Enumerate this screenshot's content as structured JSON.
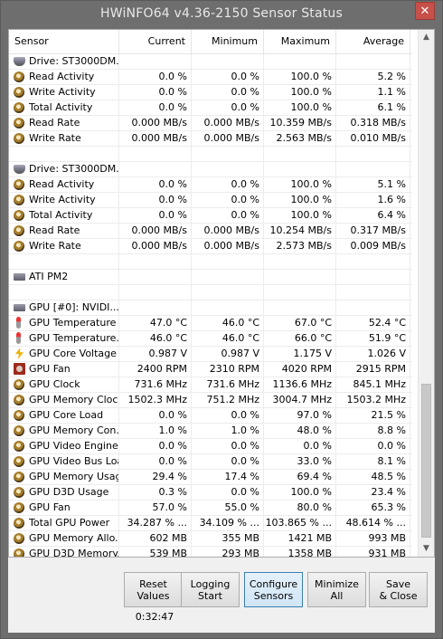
{
  "window": {
    "title": "HWiNFO64 v4.36-2150 Sensor Status",
    "close_glyph": "✕"
  },
  "columns": {
    "sensor": "Sensor",
    "current": "Current",
    "minimum": "Minimum",
    "maximum": "Maximum",
    "average": "Average"
  },
  "rows": [
    {
      "icon": "drive-icon",
      "name": "Drive: ST3000DM...",
      "cur": "",
      "min": "",
      "max": "",
      "avg": ""
    },
    {
      "icon": "gauge-icon",
      "name": "Read Activity",
      "cur": "0.0 %",
      "min": "0.0 %",
      "max": "100.0 %",
      "avg": "5.2 %"
    },
    {
      "icon": "gauge-icon",
      "name": "Write Activity",
      "cur": "0.0 %",
      "min": "0.0 %",
      "max": "100.0 %",
      "avg": "1.1 %"
    },
    {
      "icon": "gauge-icon",
      "name": "Total Activity",
      "cur": "0.0 %",
      "min": "0.0 %",
      "max": "100.0 %",
      "avg": "6.1 %"
    },
    {
      "icon": "gauge-icon",
      "name": "Read Rate",
      "cur": "0.000 MB/s",
      "min": "0.000 MB/s",
      "max": "10.359 MB/s",
      "avg": "0.318 MB/s"
    },
    {
      "icon": "gauge-icon",
      "name": "Write Rate",
      "cur": "0.000 MB/s",
      "min": "0.000 MB/s",
      "max": "2.563 MB/s",
      "avg": "0.010 MB/s"
    },
    {
      "icon": "",
      "name": "",
      "cur": "",
      "min": "",
      "max": "",
      "avg": ""
    },
    {
      "icon": "drive-icon",
      "name": "Drive: ST3000DM...",
      "cur": "",
      "min": "",
      "max": "",
      "avg": ""
    },
    {
      "icon": "gauge-icon",
      "name": "Read Activity",
      "cur": "0.0 %",
      "min": "0.0 %",
      "max": "100.0 %",
      "avg": "5.1 %"
    },
    {
      "icon": "gauge-icon",
      "name": "Write Activity",
      "cur": "0.0 %",
      "min": "0.0 %",
      "max": "100.0 %",
      "avg": "1.6 %"
    },
    {
      "icon": "gauge-icon",
      "name": "Total Activity",
      "cur": "0.0 %",
      "min": "0.0 %",
      "max": "100.0 %",
      "avg": "6.4 %"
    },
    {
      "icon": "gauge-icon",
      "name": "Read Rate",
      "cur": "0.000 MB/s",
      "min": "0.000 MB/s",
      "max": "10.254 MB/s",
      "avg": "0.317 MB/s"
    },
    {
      "icon": "gauge-icon",
      "name": "Write Rate",
      "cur": "0.000 MB/s",
      "min": "0.000 MB/s",
      "max": "2.573 MB/s",
      "avg": "0.009 MB/s"
    },
    {
      "icon": "",
      "name": "",
      "cur": "",
      "min": "",
      "max": "",
      "avg": ""
    },
    {
      "icon": "chip-icon",
      "name": "ATI PM2",
      "cur": "",
      "min": "",
      "max": "",
      "avg": ""
    },
    {
      "icon": "",
      "name": "",
      "cur": "",
      "min": "",
      "max": "",
      "avg": ""
    },
    {
      "icon": "chip-icon",
      "name": "GPU [#0]: NVIDI...",
      "cur": "",
      "min": "",
      "max": "",
      "avg": ""
    },
    {
      "icon": "thermometer-icon",
      "name": "GPU Temperature",
      "cur": "47.0 °C",
      "min": "46.0 °C",
      "max": "67.0 °C",
      "avg": "52.4 °C"
    },
    {
      "icon": "thermometer-icon",
      "name": "GPU Temperature...",
      "cur": "46.0 °C",
      "min": "46.0 °C",
      "max": "66.0 °C",
      "avg": "51.9 °C"
    },
    {
      "icon": "voltage-icon",
      "name": "GPU Core Voltage",
      "cur": "0.987 V",
      "min": "0.987 V",
      "max": "1.175 V",
      "avg": "1.026 V"
    },
    {
      "icon": "fan-icon",
      "name": "GPU Fan",
      "cur": "2400 RPM",
      "min": "2310 RPM",
      "max": "4020 RPM",
      "avg": "2915 RPM"
    },
    {
      "icon": "gauge-icon",
      "name": "GPU Clock",
      "cur": "731.6 MHz",
      "min": "731.6 MHz",
      "max": "1136.6 MHz",
      "avg": "845.1 MHz"
    },
    {
      "icon": "gauge-icon",
      "name": "GPU Memory Clock",
      "cur": "1502.3 MHz",
      "min": "751.2 MHz",
      "max": "3004.7 MHz",
      "avg": "1503.2 MHz"
    },
    {
      "icon": "gauge-icon",
      "name": "GPU Core Load",
      "cur": "0.0 %",
      "min": "0.0 %",
      "max": "97.0 %",
      "avg": "21.5 %"
    },
    {
      "icon": "gauge-icon",
      "name": "GPU Memory Con...",
      "cur": "1.0 %",
      "min": "1.0 %",
      "max": "48.0 %",
      "avg": "8.8 %"
    },
    {
      "icon": "gauge-icon",
      "name": "GPU Video Engine...",
      "cur": "0.0 %",
      "min": "0.0 %",
      "max": "0.0 %",
      "avg": "0.0 %"
    },
    {
      "icon": "gauge-icon",
      "name": "GPU Video Bus Load",
      "cur": "0.0 %",
      "min": "0.0 %",
      "max": "33.0 %",
      "avg": "8.1 %"
    },
    {
      "icon": "gauge-icon",
      "name": "GPU Memory Usage",
      "cur": "29.4 %",
      "min": "17.4 %",
      "max": "69.4 %",
      "avg": "48.5 %"
    },
    {
      "icon": "gauge-icon",
      "name": "GPU D3D Usage",
      "cur": "0.3 %",
      "min": "0.0 %",
      "max": "100.0 %",
      "avg": "23.4 %"
    },
    {
      "icon": "gauge-icon",
      "name": "GPU Fan",
      "cur": "57.0 %",
      "min": "55.0 %",
      "max": "80.0 %",
      "avg": "65.3 %"
    },
    {
      "icon": "gauge-icon",
      "name": "Total GPU Power",
      "cur": "34.287 % ...",
      "min": "34.109 % ...",
      "max": "103.865 % ...",
      "avg": "48.614 % ..."
    },
    {
      "icon": "gauge-icon",
      "name": "GPU Memory Allo...",
      "cur": "602 MB",
      "min": "355 MB",
      "max": "1421 MB",
      "avg": "993 MB"
    },
    {
      "icon": "gauge-icon",
      "name": "GPU D3D Memory...",
      "cur": "539 MB",
      "min": "293 MB",
      "max": "1358 MB",
      "avg": "931 MB"
    }
  ],
  "scrollbar": {
    "up": "▲",
    "down": "▼"
  },
  "buttons": {
    "reset": [
      "Reset",
      "Values"
    ],
    "logging": [
      "Logging",
      "Start"
    ],
    "configure": [
      "Configure",
      "Sensors"
    ],
    "minimize": [
      "Minimize",
      "All"
    ],
    "save_close": [
      "Save",
      "& Close"
    ]
  },
  "timer": "0:32:47"
}
